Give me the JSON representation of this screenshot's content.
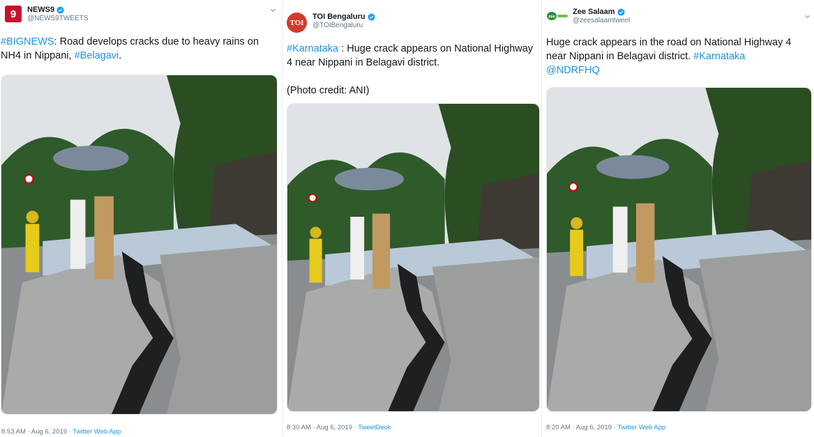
{
  "colors": {
    "link": "#1b95e0",
    "verified": "#1da1f2",
    "secondary_text": "#657786",
    "news9_red": "#c8102e",
    "toi_red": "#d33a2c",
    "zee_green": "#2e8b3c"
  },
  "tweets": [
    {
      "avatar_text": "9",
      "display_name": "NEWS9",
      "handle": "@NEWS9TWEETS",
      "text_parts": [
        "#BIGNEWS",
        ": Road develops cracks due to heavy rains on NH4 in Nippani, ",
        "#Belagavi",
        "."
      ],
      "time": "8:53 AM · Aug 6, 2019 · ",
      "app": "Twitter Web App"
    },
    {
      "avatar_text": "TOI",
      "display_name": "TOI Bengaluru",
      "handle": "@TOIBengaluru",
      "text_parts": [
        "#Karnataka",
        " : Huge crack appears on National Highway 4 near Nippani in Belagavi district."
      ],
      "credit": "(Photo credit: ANI)",
      "time": "8:30 AM · Aug 6, 2019 · ",
      "app": "TweetDeck"
    },
    {
      "avatar_text": "zee",
      "display_name": "Zee Salaam",
      "handle": "@zeesalaamtweet",
      "text_parts": [
        "Huge crack appears in the road on National Highway 4 near Nippani in Belagavi district. ",
        "#Karnataka",
        "@NDRFHQ"
      ],
      "time": "8:20 AM · Aug 6, 2019 · ",
      "app": "Twitter Web App"
    }
  ]
}
